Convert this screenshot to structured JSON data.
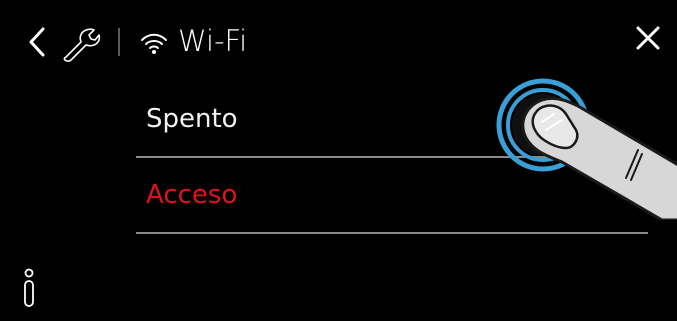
{
  "header": {
    "title": "Wi-Fi",
    "back_icon": "chevron-left-icon",
    "settings_icon": "wrench-icon",
    "wifi_icon": "wifi-icon",
    "close_icon": "close-icon"
  },
  "options": {
    "off_label": "Spento",
    "on_label": "Acceso"
  },
  "footer": {
    "info_icon": "info-icon"
  },
  "colors": {
    "background": "#000000",
    "text": "#ffffff",
    "selected": "#e0131b",
    "divider": "#8a8a8a",
    "touch_ring": "#3a9fd6"
  },
  "overlay": {
    "gesture": "tap-finger-icon"
  }
}
